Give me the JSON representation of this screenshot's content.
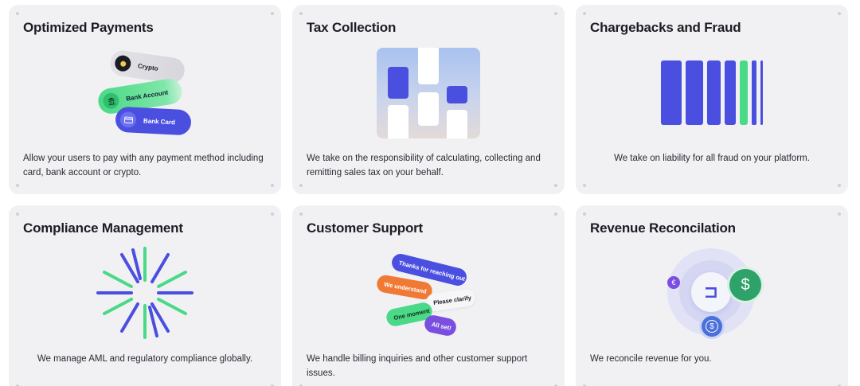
{
  "colors": {
    "card_bg": "#f1f1f4",
    "indigo": "#4b4fe0",
    "green": "#49d987",
    "orange": "#f07a35",
    "purple": "#7a4fe0",
    "dark_green": "#2fa26a"
  },
  "cards": [
    {
      "title": "Optimized Payments",
      "description": "Allow your users to pay with any payment method including card, bank account or crypto.",
      "pills": {
        "crypto": "Crypto",
        "bank_account": "Bank Account",
        "bank_card": "Bank Card"
      },
      "icons": [
        "coin-icon",
        "bank-icon",
        "card-icon"
      ]
    },
    {
      "title": "Tax Collection",
      "description": "We take on the responsibility of calculating, collecting and remitting sales tax on your behalf."
    },
    {
      "title": "Chargebacks and Fraud",
      "description": "We take on liability for all fraud on your platform."
    },
    {
      "title": "Compliance Management",
      "description": "We manage AML and regulatory compliance globally."
    },
    {
      "title": "Customer Support",
      "description": "We handle billing inquiries and other customer support issues.",
      "chat": {
        "thanks": "Thanks for reaching out",
        "understand": "We understand",
        "clarify": "Please clarify",
        "moment": "One moment",
        "all_set": "All set!"
      }
    },
    {
      "title": "Revenue Reconcilation",
      "description": "We reconcile revenue for you.",
      "symbols": {
        "euro": "€",
        "dollar": "$",
        "logo": "⊐"
      }
    }
  ]
}
